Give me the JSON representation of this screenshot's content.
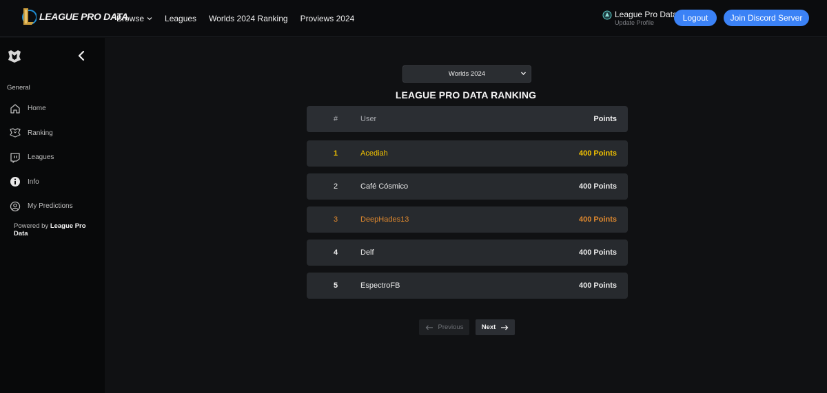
{
  "header": {
    "logo_text": "League Pro Data",
    "nav": [
      {
        "label": "Browse",
        "has_dropdown": true
      },
      {
        "label": "Leagues"
      },
      {
        "label": "Worlds 2024 Ranking"
      },
      {
        "label": "Proviews 2024"
      }
    ],
    "profile": {
      "name": "League Pro Data",
      "sub": "Update Profile"
    },
    "logout_label": "Logout",
    "discord_label": "Join Discord Server",
    "accent_color": "#3b82f6"
  },
  "sidebar": {
    "section": "General",
    "items": [
      {
        "label": "Home",
        "icon": "home-icon"
      },
      {
        "label": "Ranking",
        "icon": "trophy-icon"
      },
      {
        "label": "Leagues",
        "icon": "twitch-icon"
      },
      {
        "label": "Info",
        "icon": "info-icon"
      },
      {
        "label": "My Predictions",
        "icon": "user-circle-icon"
      }
    ],
    "powered_prefix": "Powered by ",
    "powered_brand": "League Pro Data"
  },
  "main": {
    "select_value": "Worlds 2024",
    "title": "LEAGUE PRO DATA RANKING",
    "table": {
      "headers": {
        "rank": "#",
        "user": "User",
        "points": "Points"
      },
      "rows": [
        {
          "rank": "1",
          "user": "Acediah",
          "points": "400 Points",
          "color": "#f5c400"
        },
        {
          "rank": "2",
          "user": "Café Cósmico",
          "points": "400 Points",
          "color": "#ececec"
        },
        {
          "rank": "3",
          "user": "DeepHades13",
          "points": "400 Points",
          "color": "#e0892e"
        },
        {
          "rank": "4",
          "user": "Delf",
          "points": "400 Points",
          "color": "#ececec"
        },
        {
          "rank": "5",
          "user": "EspectroFB",
          "points": "400 Points",
          "color": "#ececec"
        }
      ]
    },
    "pagination": {
      "prev_label": "Previous",
      "next_label": "Next"
    }
  }
}
